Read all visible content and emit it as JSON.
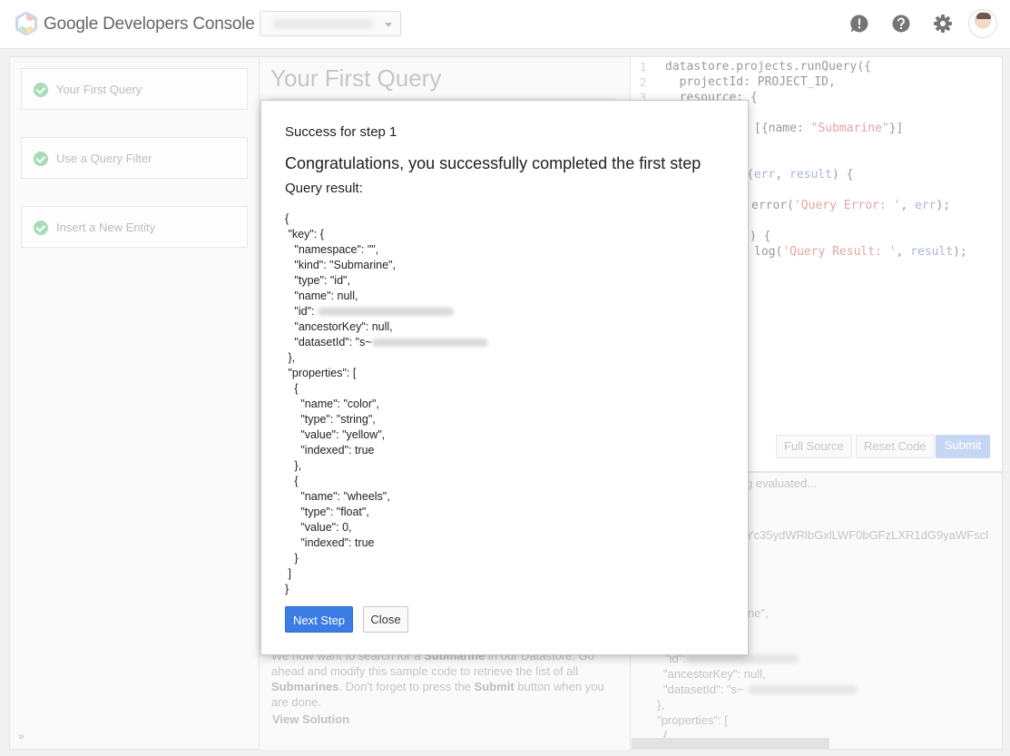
{
  "header": {
    "app_title": "Google Developers Console",
    "icons": [
      "feedback-icon",
      "help-icon",
      "settings-icon",
      "avatar"
    ]
  },
  "steps": [
    {
      "label": "Your First Query",
      "status": "completed"
    },
    {
      "label": "Use a Query Filter",
      "status": "completed"
    },
    {
      "label": "Insert a New Entity",
      "status": "completed"
    }
  ],
  "sidebar_toggle": "»",
  "tutorial": {
    "title": "Your First Query",
    "instruction_parts": {
      "p1": "We now want to search for a ",
      "b1": "Submarine",
      "p2": " in our Datastore. Go ahead and modify this sample code to retrieve the list of all ",
      "b2": "Submarines",
      "p3": ". Don't forget to press the ",
      "b3": "Submit",
      "p4": " button when you are done."
    },
    "view_solution": "View Solution"
  },
  "editor": {
    "line_numbers": [
      "1",
      "2",
      "3"
    ],
    "lines": {
      "l1": "datastore.projects.runQuery({",
      "l2": "  projectId: PROJECT_ID,",
      "l3": "  resource: {",
      "l5a": "[{name: ",
      "l5s": "\"Submarine\"",
      "l5b": "}]",
      "l8a": "(",
      "l8v1": "err",
      "l8b": ", ",
      "l8v2": "result",
      "l8c": ") {",
      "l10a": "error(",
      "l10s": "'Query Error: '",
      "l10b": ", ",
      "l10v": "err",
      "l10c": ");",
      "l12": ") {",
      "l13a": "log(",
      "l13s": "'Query Result: '",
      "l13b": ", ",
      "l13v": "result",
      "l13c": ");"
    },
    "buttons": {
      "full_source": "Full Source",
      "reset_code": "Reset Code",
      "submit": "Submit"
    }
  },
  "console": {
    "evaluated": "g evaluated...",
    "key_fragment": "Yc35ydWRlbGxlLWF0bGFzLXR1dG9yaWFscl",
    "name_fragment": "ne\",",
    "id_prefix": "\"id\": ",
    "ancestor": "\"ancestorKey\": null,",
    "dataset_prefix": "\"datasetId\": \"s~",
    "close_brace": "},",
    "properties": "\"properties\": [",
    "open_brace": "{"
  },
  "modal": {
    "subtitle": "Success for step 1",
    "title": "Congratulations, you successfully completed the first step",
    "result_label": "Query result:",
    "json": {
      "l1": "{",
      "l2": " \"key\": {",
      "l3": "   \"namespace\": \"\",",
      "l4": "   \"kind\": \"Submarine\",",
      "l5": "   \"type\": \"id\",",
      "l6": "   \"name\": null,",
      "l7": "   \"id\": ",
      "l8": "   \"ancestorKey\": null,",
      "l9": "   \"datasetId\": \"s~",
      "l10": " },",
      "l11": " \"properties\": [",
      "l12": "   {",
      "l13": "     \"name\": \"color\",",
      "l14": "     \"type\": \"string\",",
      "l15": "     \"value\": \"yellow\",",
      "l16": "     \"indexed\": true",
      "l17": "   },",
      "l18": "   {",
      "l19": "     \"name\": \"wheels\",",
      "l20": "     \"type\": \"float\",",
      "l21": "     \"value\": 0,",
      "l22": "     \"indexed\": true",
      "l23": "   }",
      "l24": " ]",
      "l25": "}"
    },
    "next_button": "Next Step",
    "close_button": "Close"
  },
  "colors": {
    "primary": "#3b7de4",
    "success": "#34a853",
    "overlay": "#f1f1f1"
  }
}
